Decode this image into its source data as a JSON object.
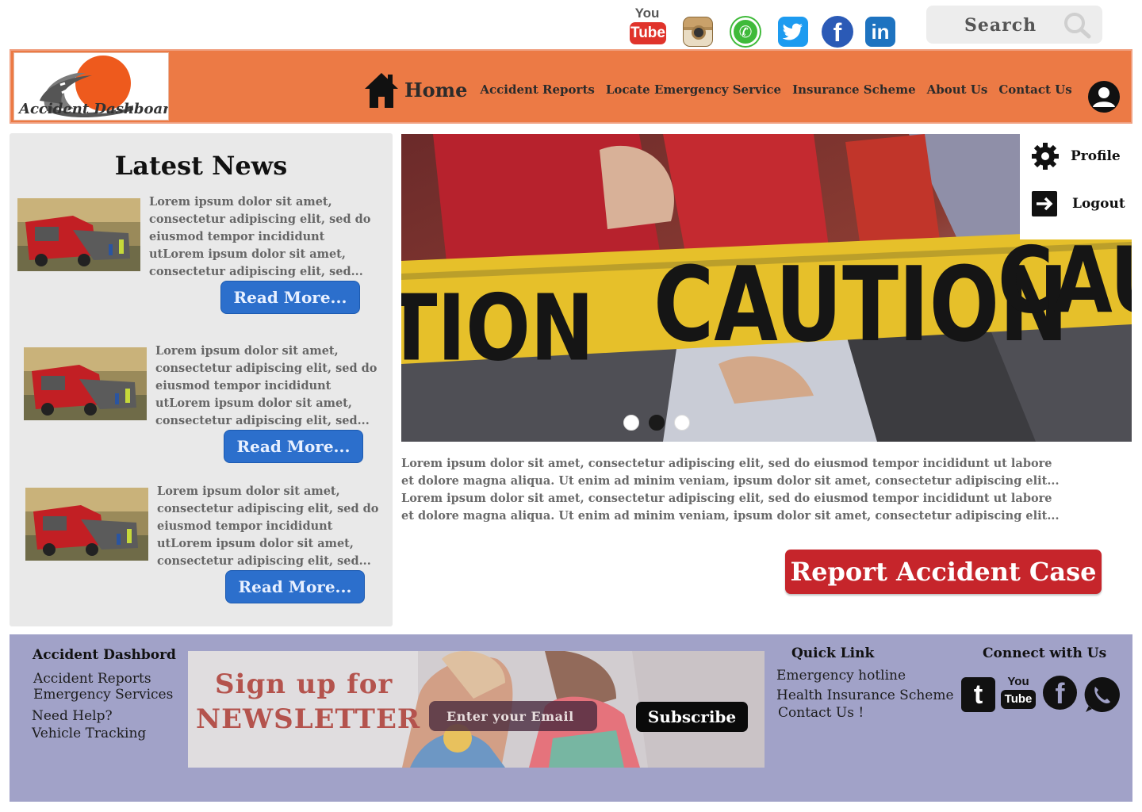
{
  "social_top": {
    "youtube": {
      "line1": "You",
      "line2": "Tube",
      "icon": "youtube-icon"
    },
    "instagram": {
      "icon": "instagram-icon"
    },
    "whatsapp": {
      "icon": "whatsapp-icon"
    },
    "twitter": {
      "icon": "twitter-icon"
    },
    "facebook": {
      "letter": "f",
      "icon": "facebook-icon"
    },
    "linkedin": {
      "letter": "in",
      "icon": "linkedin-icon"
    }
  },
  "search": {
    "label": "Search"
  },
  "brand": {
    "logo_text": "Accident Dashboard",
    "accent": "#ec7a45"
  },
  "nav": {
    "items": [
      {
        "label": "Home"
      },
      {
        "label": "Accident Reports"
      },
      {
        "label": "Locate Emergency Service"
      },
      {
        "label": "Insurance Scheme"
      },
      {
        "label": "About Us"
      },
      {
        "label": "Contact Us"
      }
    ]
  },
  "user_menu": {
    "profile": "Profile",
    "logout": "Logout"
  },
  "news": {
    "title": "Latest News",
    "read_more": "Read More...",
    "items": [
      {
        "lines": [
          "Lorem ipsum dolor sit amet,",
          "consectetur adipiscing elit, sed do",
          "eiusmod tempor incididunt",
          "utLorem ipsum dolor sit amet,",
          "consectetur adipiscing elit, sed..."
        ]
      },
      {
        "lines": [
          "Lorem ipsum dolor sit amet,",
          "consectetur adipiscing elit, sed do",
          "eiusmod tempor incididunt",
          "utLorem ipsum dolor sit amet,",
          "consectetur adipiscing elit, sed..."
        ]
      },
      {
        "lines": [
          "Lorem ipsum dolor sit amet,",
          "consectetur adipiscing elit, sed do",
          "eiusmod tempor incididunt",
          "utLorem ipsum dolor sit amet,",
          "consectetur adipiscing elit, sed..."
        ]
      }
    ]
  },
  "hero": {
    "tape_text": "CAUTION",
    "tape_left": "TION",
    "tape_right": "CAUT",
    "slides": 3,
    "active_slide": 2,
    "description": [
      "Lorem ipsum dolor sit amet, consectetur adipiscing elit, sed do eiusmod tempor incididunt ut labore",
      "et dolore magna aliqua. Ut enim ad minim veniam, ipsum dolor sit amet, consectetur adipiscing elit...",
      "Lorem ipsum dolor sit amet, consectetur adipiscing elit, sed do eiusmod tempor incididunt ut labore",
      "et dolore magna aliqua. Ut enim ad minim veniam, ipsum dolor sit amet, consectetur adipiscing elit..."
    ]
  },
  "report_button": "Report Accident Case",
  "footer": {
    "brand_heading": "Accident Dashbord",
    "brand_links": [
      "Accident Reports",
      "Emergency Services",
      "Need Help?",
      "Vehicle Tracking"
    ],
    "newsletter": {
      "line1": "Sign up for",
      "line2": "NEWSLETTER",
      "placeholder": "Enter your Email",
      "button": "Subscribe"
    },
    "quick_heading": "Quick Link",
    "quick_links": [
      "Emergency hotline",
      "Health Insurance Scheme",
      "Contact Us !"
    ],
    "connect_heading": "Connect with Us",
    "connect": {
      "tumblr": "t",
      "yt_line1": "You",
      "yt_line2": "Tube",
      "facebook": "f"
    }
  }
}
